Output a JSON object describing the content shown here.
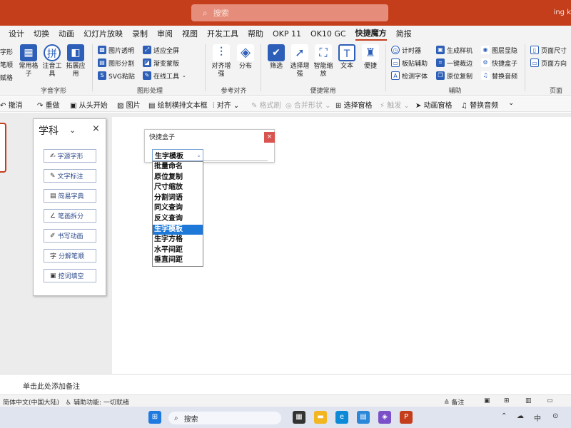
{
  "titlebar": {
    "search_placeholder": "搜索",
    "account": "ing k"
  },
  "tabs": [
    "设计",
    "切换",
    "动画",
    "幻灯片放映",
    "录制",
    "审阅",
    "视图",
    "开发工具",
    "帮助",
    "OKP 11",
    "OK10 GC",
    "快捷魔方",
    "简报"
  ],
  "active_tab": "快捷魔方",
  "ribbon": {
    "group0": {
      "items": [
        "字形",
        "笔顺",
        "赋格"
      ]
    },
    "group1": {
      "label": "字音字形",
      "items": [
        "常用格子",
        "注音工具",
        "拓展应用"
      ]
    },
    "group2": {
      "label": "图形处理",
      "items": [
        "图片透明",
        "图形分割",
        "SVG粘贴",
        "适应全屏",
        "渐变蒙版",
        "在线工具"
      ]
    },
    "group3": {
      "label": "参考对齐",
      "items": [
        "对齐增强",
        "分布"
      ]
    },
    "group4": {
      "label": "便捷常用",
      "items": [
        "筛选",
        "选择增强",
        "智能缩放",
        "文本",
        "便捷"
      ]
    },
    "group5": {
      "label": "辅助",
      "items": [
        "计时器",
        "板贴辅助",
        "检测字体",
        "生成样机",
        "一键裁边",
        "原位复制",
        "图层显隐",
        "快捷盒子",
        "替换音频"
      ]
    },
    "group6": {
      "label": "页面",
      "items": [
        "页面尺寸",
        "页面方向"
      ]
    }
  },
  "qat": {
    "items": [
      "撤消",
      "重做",
      "从头开始",
      "图片",
      "绘制横排文本框",
      "对齐",
      "格式刷",
      "合并形状",
      "选择窗格",
      "触发",
      "动画窗格",
      "替换音频"
    ]
  },
  "panel": {
    "title": "学科",
    "buttons": [
      "字源字形",
      "文字标注",
      "简易字典",
      "笔画拆分",
      "书写动画",
      "分解笔顺",
      "挖词填空"
    ]
  },
  "quickbox": {
    "title": "快捷盒子",
    "selected": "生字模板",
    "options": [
      "批量命名",
      "原位复制",
      "尺寸缩放",
      "分割词语",
      "同义查询",
      "反义查询",
      "生字模板",
      "生字方格",
      "水平间距",
      "垂直间距"
    ]
  },
  "notes": {
    "placeholder": "单击此处添加备注"
  },
  "status": {
    "language": "简体中文(中国大陆)",
    "accessibility": "辅助功能: 一切就绪",
    "notes_btn": "备注"
  },
  "taskbar": {
    "search": "搜索",
    "ime": "中"
  },
  "colors": {
    "accent": "#c43e1c",
    "selection": "#1e78d8"
  }
}
